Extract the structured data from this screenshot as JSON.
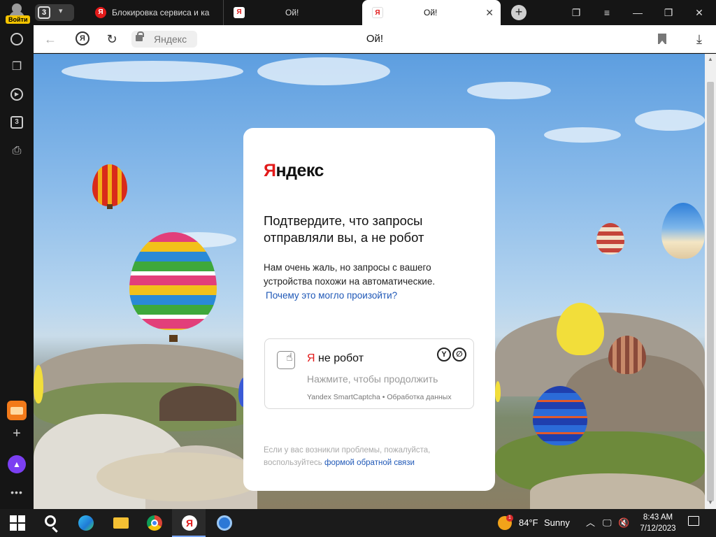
{
  "browser": {
    "profile_login_label": "Войти",
    "tab_group_count": "3",
    "tabs": [
      {
        "title": "Блокировка сервиса и ка",
        "favicon": "yandex-icon"
      },
      {
        "title": "Ой!",
        "favicon": "yandex-icon"
      },
      {
        "title": "Ой!",
        "favicon": "yandex-icon",
        "active": true
      }
    ],
    "address_host": "Яндекс",
    "page_title": "Ой!",
    "yandex_button_glyph": "Я",
    "sidebar_counter": "3"
  },
  "captcha": {
    "logo_first": "Я",
    "logo_rest": "ндекс",
    "heading": "Подтвердите, что запросы отправляли вы, а не робот",
    "description": "Нам очень жаль, но запросы с вашего устройства похожи на автоматические.",
    "why_link": "Почему это могло произойти?",
    "checkbox": {
      "label_prefix": "Я",
      "label_rest": "не робот",
      "hint": "Нажмите, чтобы продолжить",
      "footer": "Yandex SmartCaptcha • Обработка данных",
      "checked": false
    },
    "help_text": "Если у вас возникли проблемы, пожалуйста, воспользуйтесь",
    "help_link": "формой обратной связи"
  },
  "taskbar": {
    "apps": [
      "windows-start",
      "search",
      "edge",
      "file-explorer",
      "chrome",
      "yandex-browser",
      "camera-app"
    ],
    "weather_badge": "1",
    "weather_temp": "84°F",
    "weather_text": "Sunny",
    "time": "8:43 AM",
    "date": "7/12/2023"
  },
  "colors": {
    "yandex_red": "#e21a1a",
    "link_blue": "#1f58b7",
    "chrome_dark": "#151515"
  }
}
